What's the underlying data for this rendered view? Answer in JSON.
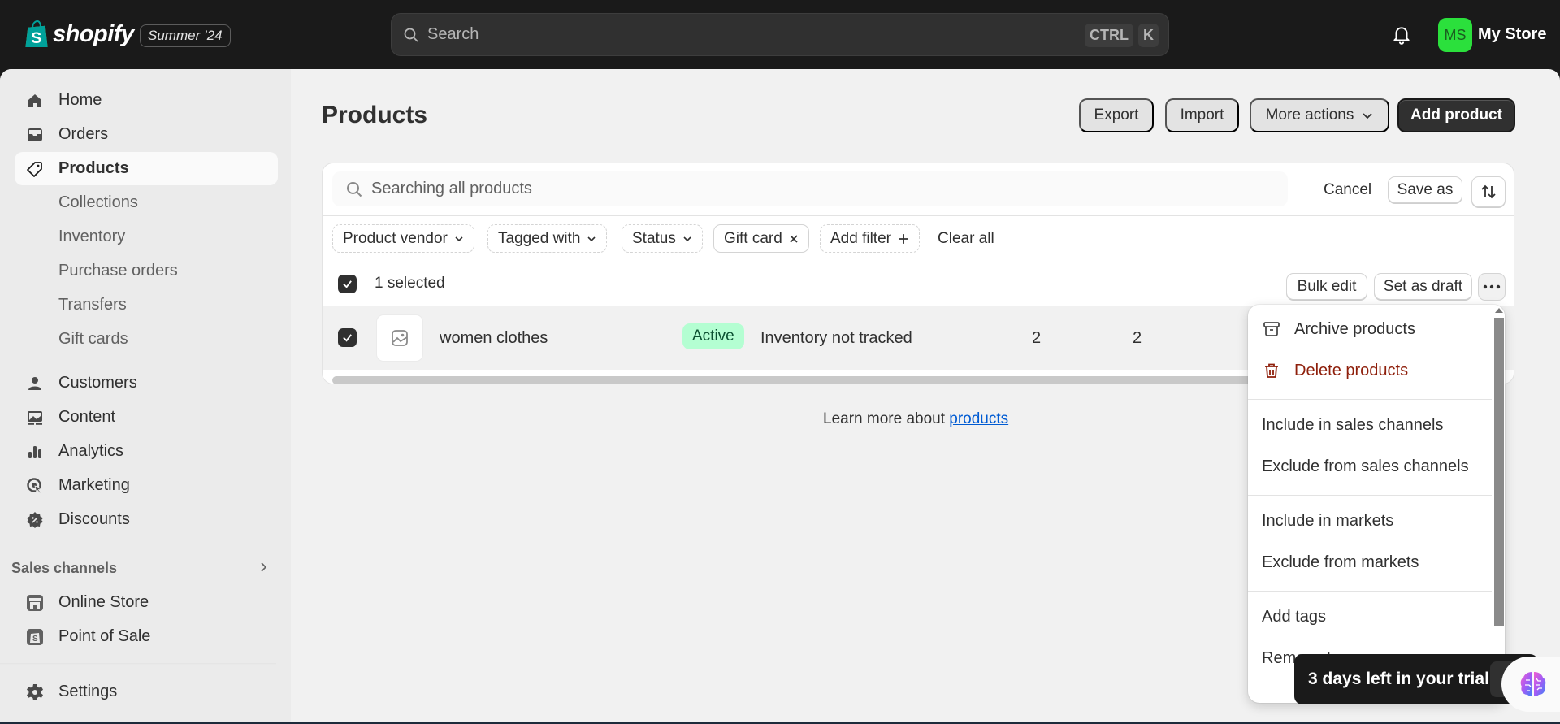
{
  "topbar": {
    "brand": "shopify",
    "edition": "Summer ’24",
    "search_placeholder": "Search",
    "shortcut_keys": [
      "CTRL",
      "K"
    ],
    "avatar_initials": "MS",
    "store_name": "My Store",
    "avatar_color": "#2be03c"
  },
  "sidebar": {
    "items": [
      {
        "label": "Home",
        "icon": "home-icon"
      },
      {
        "label": "Orders",
        "icon": "inbox-icon"
      },
      {
        "label": "Products",
        "icon": "tag-icon",
        "active": true
      },
      {
        "label": "Collections",
        "sub": true
      },
      {
        "label": "Inventory",
        "sub": true
      },
      {
        "label": "Purchase orders",
        "sub": true
      },
      {
        "label": "Transfers",
        "sub": true
      },
      {
        "label": "Gift cards",
        "sub": true
      },
      {
        "label": "Customers",
        "icon": "person-icon"
      },
      {
        "label": "Content",
        "icon": "content-icon"
      },
      {
        "label": "Analytics",
        "icon": "bar-chart-icon"
      },
      {
        "label": "Marketing",
        "icon": "target-icon"
      },
      {
        "label": "Discounts",
        "icon": "discount-icon"
      }
    ],
    "sales_channels_label": "Sales channels",
    "channels": [
      {
        "label": "Online Store",
        "icon": "store-icon"
      },
      {
        "label": "Point of Sale",
        "icon": "pos-icon"
      }
    ],
    "settings_label": "Settings"
  },
  "page": {
    "title": "Products",
    "actions": {
      "export": "Export",
      "import": "Import",
      "more_actions": "More actions",
      "add_product": "Add product"
    }
  },
  "filters": {
    "search_placeholder": "Searching all products",
    "cancel": "Cancel",
    "save_as": "Save as",
    "pills": [
      {
        "label": "Product vendor",
        "type": "dropdown"
      },
      {
        "label": "Tagged with",
        "type": "dropdown"
      },
      {
        "label": "Status",
        "type": "dropdown"
      },
      {
        "label": "Gift card",
        "type": "applied"
      },
      {
        "label": "Add filter",
        "type": "add"
      }
    ],
    "clear_all": "Clear all"
  },
  "bulk": {
    "selected_text": "1 selected",
    "bulk_edit": "Bulk edit",
    "set_as_draft": "Set as draft"
  },
  "table": {
    "rows": [
      {
        "checked": true,
        "name": "women clothes",
        "status": "Active",
        "inventory": "Inventory not tracked",
        "col4": "2",
        "col5": "2"
      }
    ]
  },
  "footer": {
    "learn_more_prefix": "Learn more about ",
    "learn_more_link": "products"
  },
  "dropdown": {
    "items": [
      {
        "label": "Archive products",
        "icon": "archive-icon"
      },
      {
        "label": "Delete products",
        "icon": "trash-icon",
        "danger": true
      },
      {
        "label": "Include in sales channels"
      },
      {
        "label": "Exclude from sales channels"
      },
      {
        "label": "Include in markets"
      },
      {
        "label": "Exclude from markets"
      },
      {
        "label": "Add tags"
      },
      {
        "label": "Remove tags"
      }
    ]
  },
  "trial_banner": {
    "text": "3 days left in your trial"
  }
}
